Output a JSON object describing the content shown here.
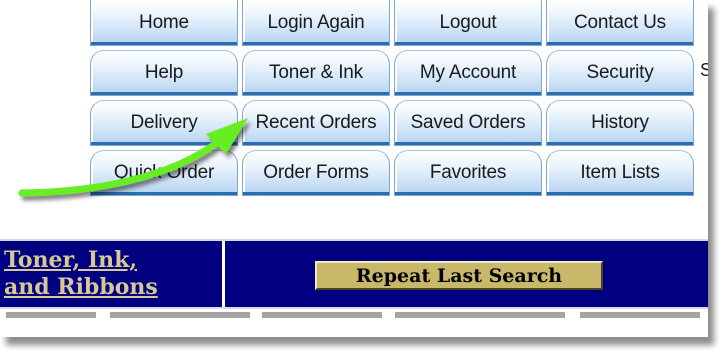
{
  "nav": {
    "tabs": [
      [
        "Home",
        "Login Again",
        "Logout",
        "Contact Us"
      ],
      [
        "Help",
        "Toner & Ink",
        "My Account",
        "Security"
      ],
      [
        "Delivery",
        "Recent Orders",
        "Saved Orders",
        "History"
      ],
      [
        "Quick Order",
        "Order Forms",
        "Favorites",
        "Item Lists"
      ]
    ],
    "edge_text": "S"
  },
  "banner": {
    "link_line1": "Toner, Ink,",
    "link_line2": "and Ribbons",
    "repeat_label": "Repeat Last Search"
  },
  "colors": {
    "banner_bg": "#000080",
    "button_bg": "#c9b86a",
    "link": "#d7c894",
    "tab_accent": "#2a6db0",
    "annotation_arrow": "#66ee22"
  },
  "annotation": {
    "arrow_target": "Recent Orders"
  }
}
